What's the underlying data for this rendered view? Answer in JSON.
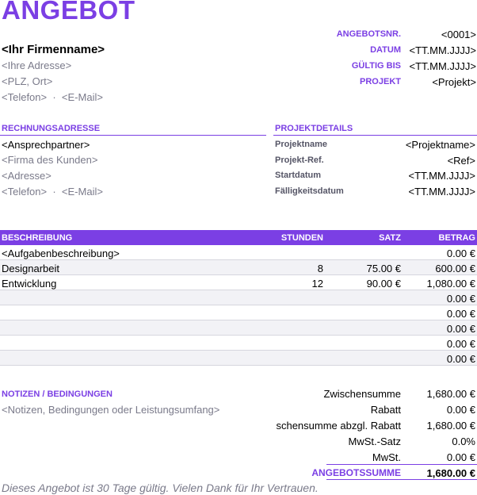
{
  "title": "ANGEBOT",
  "company": {
    "name": "<Ihr Firmenname>",
    "address": "<Ihre Adresse>",
    "city": "<PLZ, Ort>",
    "phone": "<Telefon>",
    "separator": "·",
    "email": "<E-Mail>"
  },
  "meta": [
    {
      "label": "ANGEBOTSNR.",
      "value": "<0001>"
    },
    {
      "label": "DATUM",
      "value": "<TT.MM.JJJJ>"
    },
    {
      "label": "GÜLTIG BIS",
      "value": "<TT.MM.JJJJ>"
    },
    {
      "label": "PROJEKT",
      "value": "<Projekt>"
    }
  ],
  "billing": {
    "heading": "RECHNUNGSADRESSE",
    "contact": "<Ansprechpartner>",
    "company": "<Firma des Kunden>",
    "address": "<Adresse>",
    "phone": "<Telefon>",
    "separator": "·",
    "email": "<E-Mail>"
  },
  "project": {
    "heading": "PROJEKTDETAILS",
    "rows": [
      {
        "label": "Projektname",
        "value": "<Projektname>"
      },
      {
        "label": "Projekt-Ref.",
        "value": "<Ref>"
      },
      {
        "label": "Startdatum",
        "value": "<TT.MM.JJJJ>"
      },
      {
        "label": "Fälligkeitsdatum",
        "value": "<TT.MM.JJJJ>"
      }
    ]
  },
  "table": {
    "headers": {
      "desc": "BESCHREIBUNG",
      "hours": "STUNDEN",
      "rate": "SATZ",
      "amount": "BETRAG"
    },
    "rows": [
      {
        "desc": "<Aufgabenbeschreibung>",
        "hours": "",
        "rate": "",
        "amount": "0.00 €"
      },
      {
        "desc": "Designarbeit",
        "hours": "8",
        "rate": "75.00 €",
        "amount": "600.00 €"
      },
      {
        "desc": "Entwicklung",
        "hours": "12",
        "rate": "90.00 €",
        "amount": "1,080.00 €"
      },
      {
        "desc": "",
        "hours": "",
        "rate": "",
        "amount": "0.00 €"
      },
      {
        "desc": "",
        "hours": "",
        "rate": "",
        "amount": "0.00 €"
      },
      {
        "desc": "",
        "hours": "",
        "rate": "",
        "amount": "0.00 €"
      },
      {
        "desc": "",
        "hours": "",
        "rate": "",
        "amount": "0.00 €"
      },
      {
        "desc": "",
        "hours": "",
        "rate": "",
        "amount": "0.00 €"
      }
    ]
  },
  "notes": {
    "heading": "NOTIZEN / BEDINGUNGEN",
    "text": "<Notizen, Bedingungen oder Leistungsumfang>"
  },
  "totals": [
    {
      "label": "Zwischensumme",
      "value": "1,680.00 €"
    },
    {
      "label": "Rabatt",
      "value": "0.00 €"
    },
    {
      "label": "schensumme abzgl. Rabatt",
      "value": "1,680.00 €"
    },
    {
      "label": "MwSt.-Satz",
      "value": "0.0%"
    },
    {
      "label": "MwSt.",
      "value": "0.00 €"
    }
  ],
  "grand_total": {
    "label": "ANGEBOTSSUMME",
    "value": "1,680.00 €"
  },
  "footer": "Dieses Angebot ist 30 Tage gültig.  Vielen Dank für Ihr Vertrauen.",
  "colors": {
    "accent": "#7b3fe4",
    "muted": "#7a7a8a",
    "row_alt": "#f2f2f6"
  }
}
